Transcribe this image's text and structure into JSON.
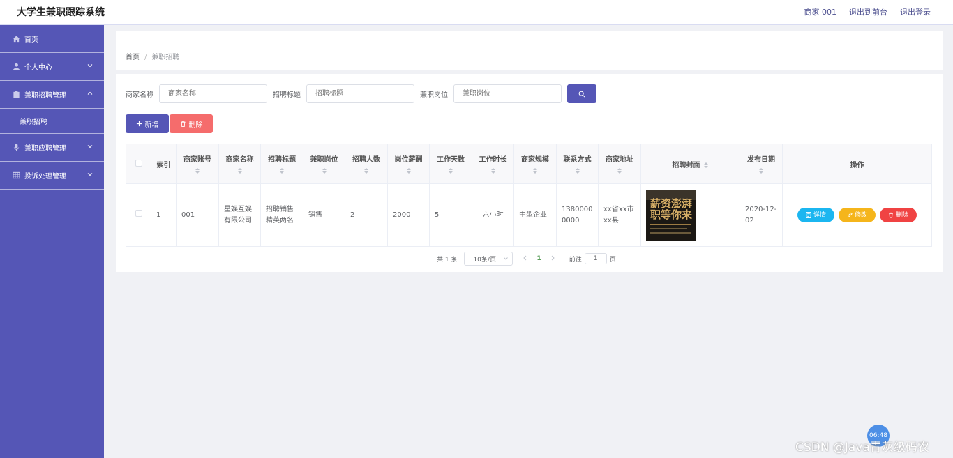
{
  "header": {
    "title": "大学生兼职跟踪系统",
    "user": "商家 001",
    "front_link": "退出到前台",
    "logout": "退出登录"
  },
  "sidebar": {
    "items": [
      {
        "label": "首页",
        "icon": "home-icon"
      },
      {
        "label": "个人中心",
        "icon": "user-icon"
      },
      {
        "label": "兼职招聘管理",
        "icon": "clipboard-icon"
      },
      {
        "label": "兼职应聘管理",
        "icon": "microphone-icon"
      },
      {
        "label": "投诉处理管理",
        "icon": "grid-icon"
      }
    ],
    "submenu_label": "兼职招聘"
  },
  "breadcrumb": {
    "home": "首页",
    "current": "兼职招聘"
  },
  "search": {
    "merchant_label": "商家名称",
    "merchant_placeholder": "商家名称",
    "title_label": "招聘标题",
    "title_placeholder": "招聘标题",
    "position_label": "兼职岗位",
    "position_placeholder": "兼职岗位"
  },
  "actions": {
    "add": "新增",
    "delete": "删除"
  },
  "table": {
    "headers": [
      "索引",
      "商家账号",
      "商家名称",
      "招聘标题",
      "兼职岗位",
      "招聘人数",
      "岗位薪酬",
      "工作天数",
      "工作时长",
      "商家规模",
      "联系方式",
      "商家地址",
      "招聘封面",
      "发布日期",
      "操作"
    ],
    "rows": [
      {
        "index": "1",
        "account": "001",
        "merchant": "星娱互娱有限公司",
        "title": "招聘销售精英两名",
        "position": "销售",
        "count": "2",
        "salary": "2000",
        "days": "5",
        "hours": "六小时",
        "scale": "中型企业",
        "phone": "13800000000",
        "address": "xx省xx市xx县",
        "cover_text": "薪资澎湃 职等你来",
        "date": "2020-12-02",
        "detail": "详情",
        "edit": "修改",
        "remove": "删除"
      }
    ]
  },
  "pager": {
    "total": "共 1 条",
    "size": "10条/页",
    "page": "1",
    "goto": "前往",
    "goto_value": "1",
    "unit": "页"
  },
  "overlay": {
    "clock": "06:48",
    "watermark": "CSDN @Java青灰级码农"
  },
  "colors": {
    "primary": "#5556b6",
    "danger": "#f56c6c",
    "info": "#1bb6f0",
    "warning": "#f5b51b"
  }
}
